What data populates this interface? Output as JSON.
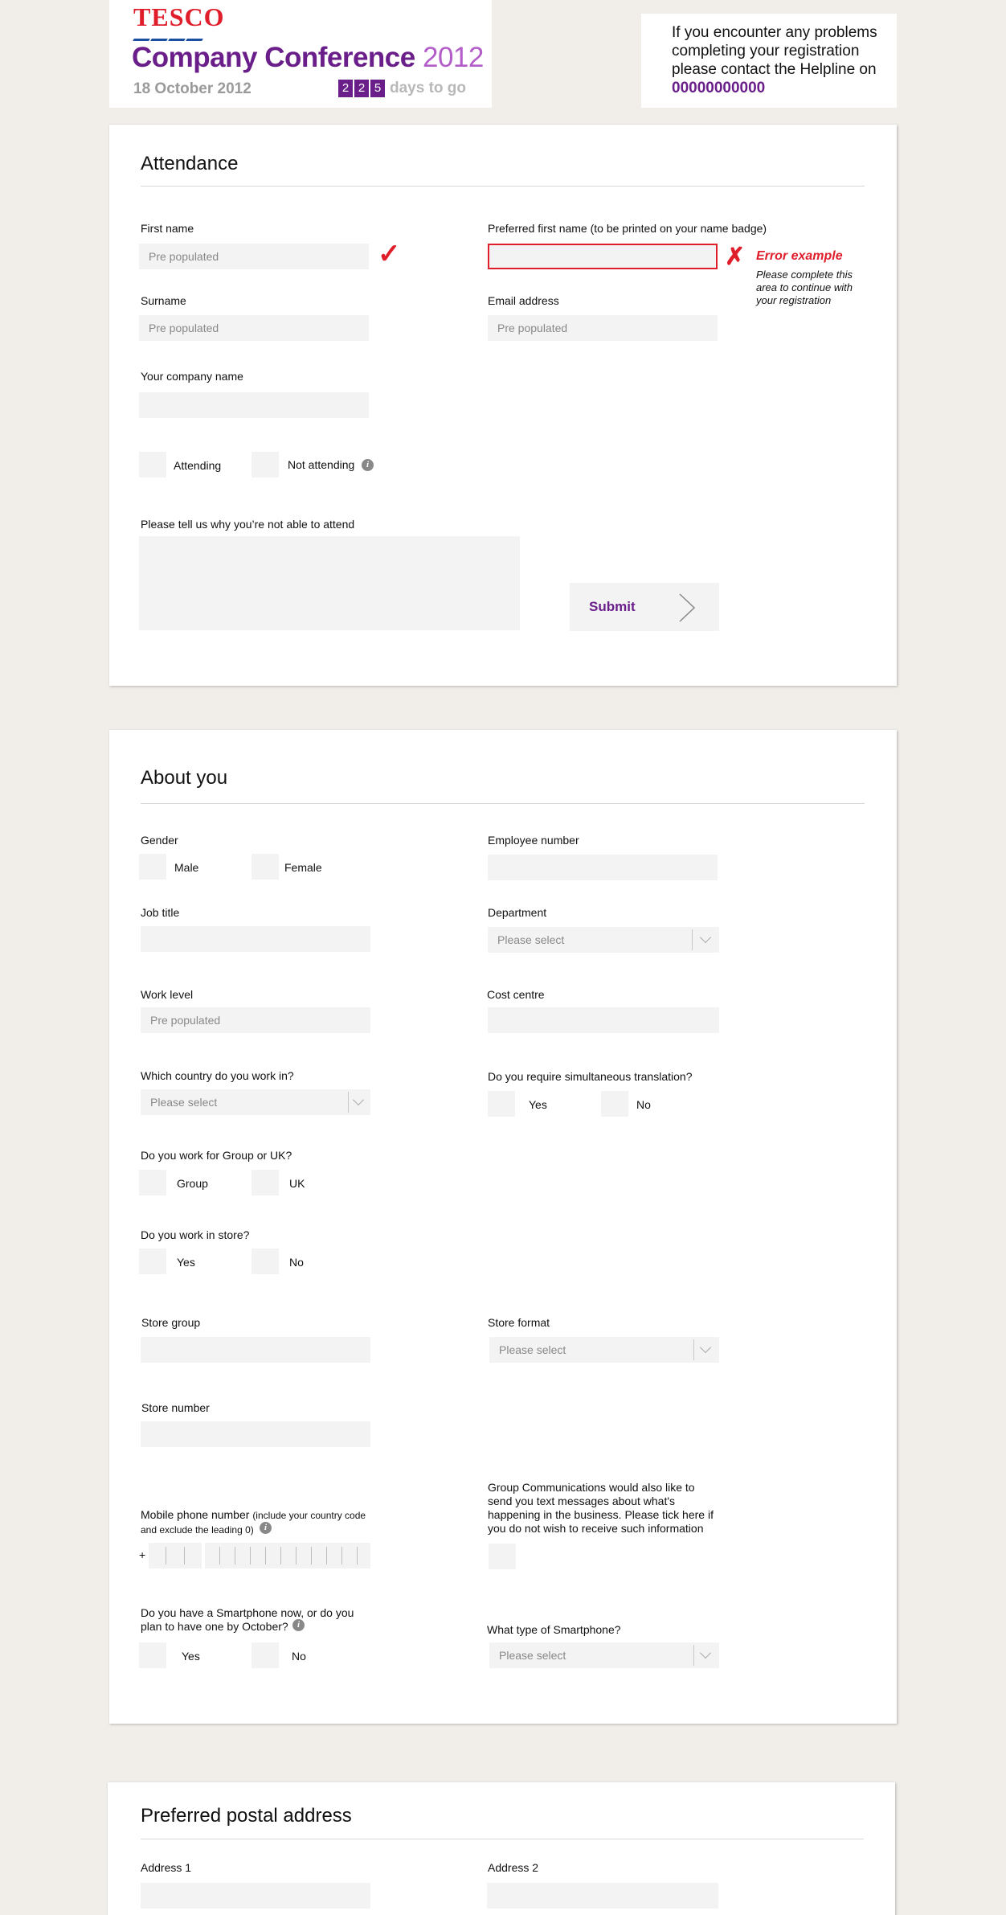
{
  "header": {
    "logo": "TESCO",
    "title": "Company Conference",
    "year": "2012",
    "date": "18 October 2012",
    "countdown_digits": [
      "2",
      "2",
      "5"
    ],
    "countdown_label": "days to go",
    "help_text": "If you encounter any problems completing your registration please contact the Helpline on",
    "help_phone": "00000000000"
  },
  "attendance": {
    "title": "Attendance",
    "first_name_label": "First name",
    "first_name_value": "Pre populated",
    "preferred_label": "Preferred first name (to be printed on your name badge)",
    "preferred_value": "",
    "error_title": "Error example",
    "error_msg": "Please complete this area to continue with your registration",
    "surname_label": "Surname",
    "surname_value": "Pre populated",
    "email_label": "Email address",
    "email_value": "Pre populated",
    "company_label": "Your company name",
    "company_value": "",
    "attending_label": "Attending",
    "not_attending_label": "Not attending",
    "reason_label": "Please tell us why you’re not able to attend",
    "reason_value": "",
    "submit_label": "Submit"
  },
  "about": {
    "title": "About you",
    "gender_label": "Gender",
    "male_label": "Male",
    "female_label": "Female",
    "employee_label": "Employee number",
    "job_title_label": "Job title",
    "department_label": "Department",
    "department_value": "Please select",
    "work_level_label": "Work level",
    "work_level_value": "Pre populated",
    "cost_centre_label": "Cost centre",
    "country_label": "Which country do you work in?",
    "country_value": "Please select",
    "translation_label": "Do you require simultaneous translation?",
    "translation_yes": "Yes",
    "translation_no": "No",
    "group_uk_label": "Do you work for Group or UK?",
    "group_label": "Group",
    "uk_label": "UK",
    "in_store_label": "Do you work in store?",
    "in_store_yes": "Yes",
    "in_store_no": "No",
    "store_group_label": "Store group",
    "store_format_label": "Store format",
    "store_format_value": "Please select",
    "store_number_label": "Store number",
    "mobile_label": "Mobile phone number",
    "mobile_note_1": "(include your country code",
    "mobile_note_2": "and exclude the leading 0)",
    "mobile_prefix": "+",
    "sms_text_1": "Group Communications would also like to",
    "sms_text_2": "send you text messages about what's",
    "sms_text_3": "happening in the business. Please tick here if",
    "sms_text_4": "you do not wish to receive such information",
    "smartphone_q_1": "Do you have a Smartphone now, or do you",
    "smartphone_q_2": "plan to have one by October?",
    "smartphone_yes": "Yes",
    "smartphone_no": "No",
    "smartphone_type_label": "What type of Smartphone?",
    "smartphone_type_value": "Please select"
  },
  "postal": {
    "title": "Preferred postal address",
    "address1_label": "Address 1",
    "address2_label": "Address 2"
  }
}
